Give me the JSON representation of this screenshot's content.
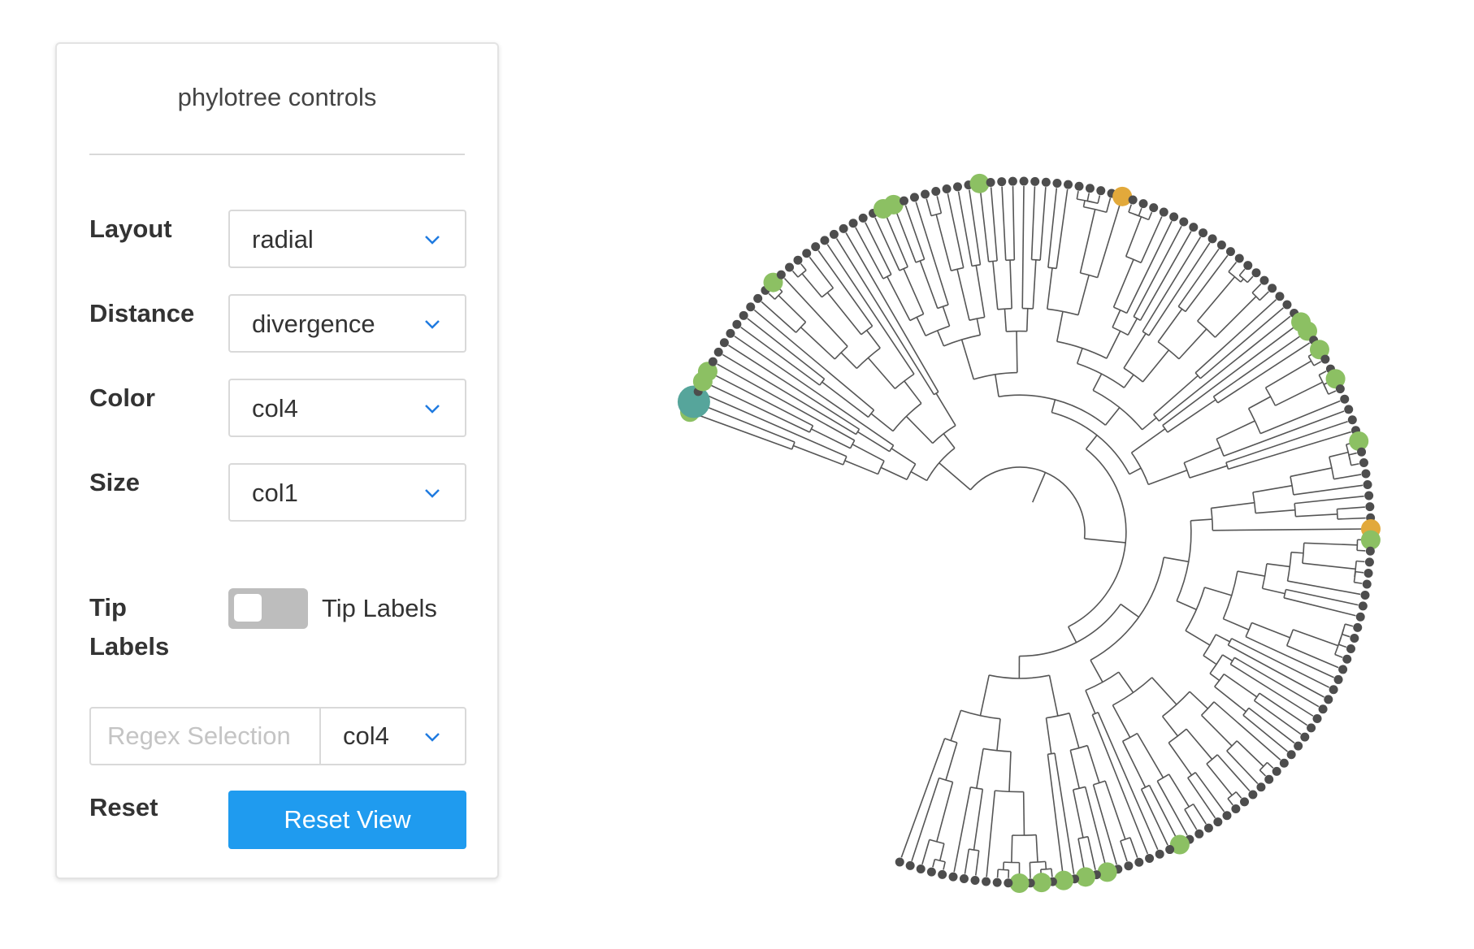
{
  "panel": {
    "title": "phylotree controls",
    "layout": {
      "label": "Layout",
      "value": "radial"
    },
    "distance": {
      "label": "Distance",
      "value": "divergence"
    },
    "color": {
      "label": "Color",
      "value": "col4"
    },
    "size": {
      "label": "Size",
      "value": "col1"
    },
    "tip_labels": {
      "label_line1": "Tip",
      "label_line2": "Labels",
      "toggle_label": "Tip Labels",
      "on": false
    },
    "regex": {
      "placeholder": "Regex Selection",
      "column": "col4"
    },
    "reset": {
      "label": "Reset",
      "button": "Reset View"
    }
  },
  "tree": {
    "layout": "radial",
    "tip_count": 150,
    "colors": {
      "branch": "#555555",
      "tip": "#4d4d4d",
      "green": "#8cc063",
      "orange": "#e2a93b",
      "teal": "#56a59b"
    },
    "highlighted_tips": [
      {
        "tip": 0,
        "color": "green"
      },
      {
        "tip": 1,
        "color": "teal"
      },
      {
        "tip": 3,
        "color": "green"
      },
      {
        "tip": 4,
        "color": "green"
      },
      {
        "tip": 14,
        "color": "green"
      },
      {
        "tip": 26,
        "color": "green"
      },
      {
        "tip": 27,
        "color": "green"
      },
      {
        "tip": 35,
        "color": "green"
      },
      {
        "tip": 48,
        "color": "orange"
      },
      {
        "tip": 68,
        "color": "green"
      },
      {
        "tip": 69,
        "color": "green"
      },
      {
        "tip": 71,
        "color": "green"
      },
      {
        "tip": 74,
        "color": "green"
      },
      {
        "tip": 80,
        "color": "green"
      },
      {
        "tip": 88,
        "color": "orange"
      },
      {
        "tip": 89,
        "color": "green"
      },
      {
        "tip": 123,
        "color": "green"
      },
      {
        "tip": 130,
        "color": "green"
      },
      {
        "tip": 132,
        "color": "green"
      },
      {
        "tip": 134,
        "color": "green"
      },
      {
        "tip": 136,
        "color": "green"
      },
      {
        "tip": 138,
        "color": "green"
      }
    ]
  }
}
